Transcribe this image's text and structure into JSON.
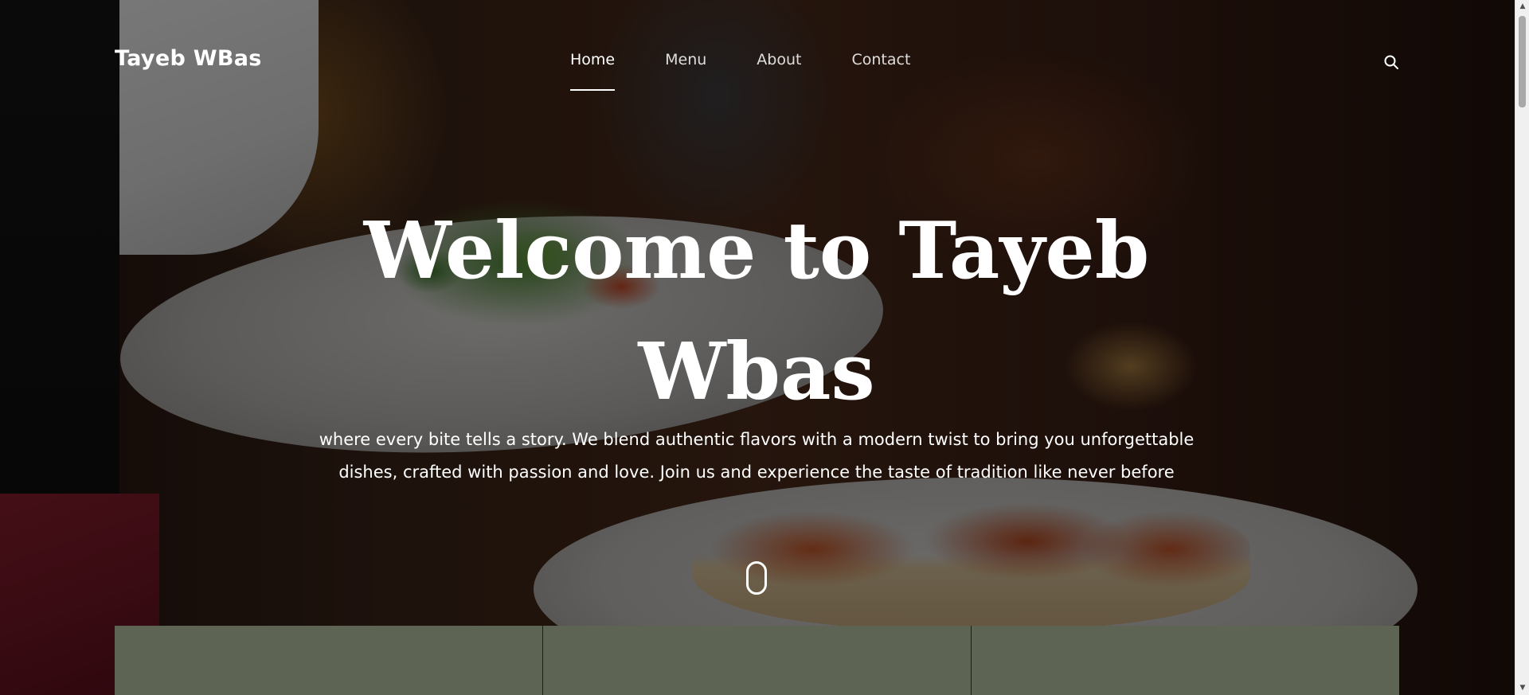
{
  "header": {
    "brand": "Tayeb WBas",
    "nav": [
      {
        "label": "Home",
        "active": true
      },
      {
        "label": "Menu",
        "active": false
      },
      {
        "label": "About",
        "active": false
      },
      {
        "label": "Contact",
        "active": false
      }
    ],
    "search_icon": "search-icon"
  },
  "hero": {
    "title": "Welcome to Tayeb Wbas",
    "subtitle": "where every bite tells a story. We blend authentic flavors with a modern twist to bring you unforgettable dishes, crafted with passion and love. Join us and experience the taste of tradition like never before",
    "scroll_icon": "mouse-scroll-icon"
  },
  "cards": {
    "color": "#5d6453",
    "count_visible": 3
  },
  "colors": {
    "text": "#ffffff",
    "card_bg": "#5d6453"
  }
}
